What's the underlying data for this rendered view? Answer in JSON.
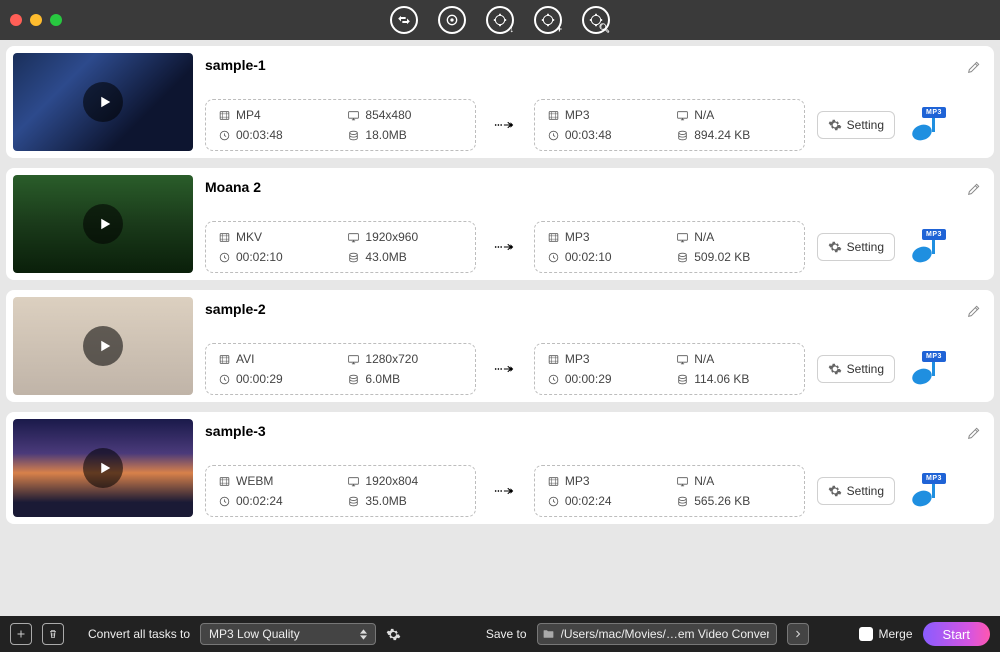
{
  "topbar": {
    "tools": [
      "convert",
      "rip",
      "video-edit",
      "video-add",
      "video-search"
    ]
  },
  "tasks": [
    {
      "title": "sample-1",
      "thumb_class": "bg1",
      "source": {
        "format": "MP4",
        "resolution": "854x480",
        "duration": "00:03:48",
        "size": "18.0MB"
      },
      "target": {
        "format": "MP3",
        "resolution": "N/A",
        "duration": "00:03:48",
        "size": "894.24 KB"
      },
      "setting_label": "Setting",
      "output_tag": "MP3"
    },
    {
      "title": "Moana 2",
      "thumb_class": "bg2",
      "source": {
        "format": "MKV",
        "resolution": "1920x960",
        "duration": "00:02:10",
        "size": "43.0MB"
      },
      "target": {
        "format": "MP3",
        "resolution": "N/A",
        "duration": "00:02:10",
        "size": "509.02 KB"
      },
      "setting_label": "Setting",
      "output_tag": "MP3"
    },
    {
      "title": "sample-2",
      "thumb_class": "bg3",
      "source": {
        "format": "AVI",
        "resolution": "1280x720",
        "duration": "00:00:29",
        "size": "6.0MB"
      },
      "target": {
        "format": "MP3",
        "resolution": "N/A",
        "duration": "00:00:29",
        "size": "114.06 KB"
      },
      "setting_label": "Setting",
      "output_tag": "MP3"
    },
    {
      "title": "sample-3",
      "thumb_class": "bg4",
      "source": {
        "format": "WEBM",
        "resolution": "1920x804",
        "duration": "00:02:24",
        "size": "35.0MB"
      },
      "target": {
        "format": "MP3",
        "resolution": "N/A",
        "duration": "00:02:24",
        "size": "565.26 KB"
      },
      "setting_label": "Setting",
      "output_tag": "MP3"
    }
  ],
  "bottom": {
    "convert_all_label": "Convert all tasks to",
    "format_selected": "MP3 Low Quality",
    "save_to_label": "Save to",
    "save_path": "/Users/mac/Movies/…em Video Converter",
    "merge_label": "Merge",
    "start_label": "Start"
  }
}
